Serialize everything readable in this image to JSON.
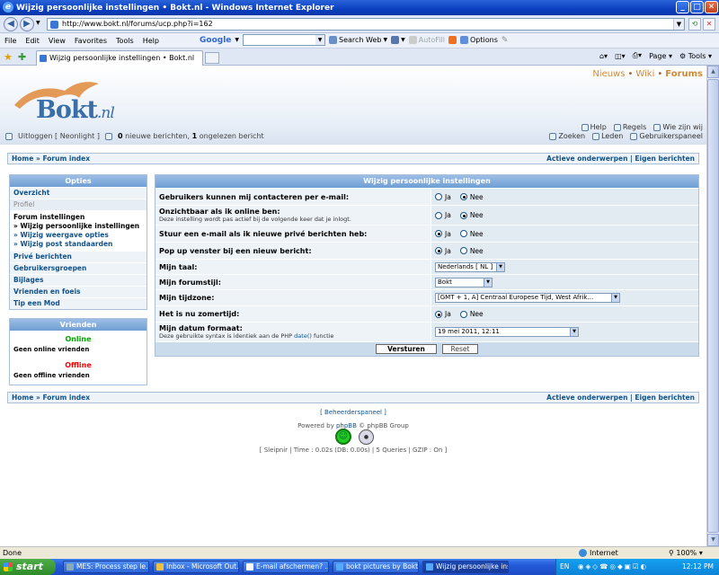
{
  "browser": {
    "window_title": "Wijzig persoonlijke instellingen • Bokt.nl - Windows Internet Explorer",
    "address": "http://www.bokt.nl/forums/ucp.php?i=162",
    "menu": [
      "File",
      "Edit",
      "View",
      "Favorites",
      "Tools",
      "Help"
    ],
    "google_label": "Google",
    "search_web_label": "Search Web",
    "autofill_label": "AutoFill",
    "options_label": "Options",
    "tab_title": "Wijzig persoonlijke instellingen • Bokt.nl",
    "page_label": "Page",
    "tools_label": "Tools",
    "status_left": "Done",
    "status_zone": "Internet",
    "zoom": "100%"
  },
  "site": {
    "topnav": [
      "Nieuws",
      "Wiki",
      "Forums"
    ],
    "logo_main": "Bokt",
    "logo_suffix": ".nl",
    "links_row1": [
      "Help",
      "Regels",
      "Wie zijn wij"
    ],
    "links_row2": [
      "Zoeken",
      "Leden",
      "Gebruikerspaneel"
    ],
    "logout_text": "Uitloggen [ Neonlight ]",
    "messages_count_new": "0",
    "messages_new_text": "nieuwe berichten,",
    "messages_count_unread": "1",
    "messages_unread_text": "ongelezen bericht",
    "crumb_home": "Home",
    "crumb_sep": "»",
    "crumb_index": "Forum index",
    "crumb_active": "Actieve onderwerpen",
    "crumb_own": "Eigen berichten"
  },
  "left": {
    "options_header": "Opties",
    "overview": "Overzicht",
    "profile": "Profiel",
    "forum_settings": "Forum instellingen",
    "sub1": "» Wijzig persoonlijke instellingen",
    "sub2": "» Wijzig weergave opties",
    "sub3": "» Wijzig post standaarden",
    "pm": "Privé berichten",
    "groups": "Gebruikersgroepen",
    "attachments": "Bijlages",
    "friends_foes": "Vrienden en foeis",
    "tip": "Tip een Mod",
    "friends_header": "Vrienden",
    "online": "Online",
    "no_online": "Geen online vrienden",
    "offline": "Offline",
    "no_offline": "Geen offline vrienden"
  },
  "form": {
    "header": "Wijzig persoonlijke instellingen",
    "yes": "Ja",
    "no": "Nee",
    "q1": "Gebruikers kunnen mij contacteren per e-mail:",
    "q2": "Onzichtbaar als ik online ben:",
    "q2_note": "Deze instelling wordt pas actief bij de volgende keer dat je inlogt.",
    "q3": "Stuur een e-mail als ik nieuwe privé berichten heb:",
    "q4": "Pop up venster bij een nieuw bericht:",
    "q5": "Mijn taal:",
    "q5_val": "Nederlands [ NL ]",
    "q6": "Mijn forumstijl:",
    "q6_val": "Bokt",
    "q7": "Mijn tijdzone:",
    "q7_val": "[GMT + 1, A] Centraal Europese Tijd, West Afrik...",
    "q8": "Het is nu zomertijd:",
    "q9": "Mijn datum formaat:",
    "q9_note": "Deze gebruikte syntax is identiek aan de PHP",
    "q9_link": "date()",
    "q9_note2": "functie",
    "q9_val": "19 mei 2011, 12:11",
    "submit": "Versturen",
    "reset": "Reset",
    "selections": {
      "q1": "no",
      "q2": "no",
      "q3": "yes",
      "q4": "yes",
      "q8": "yes"
    }
  },
  "footer": {
    "admin": "[ Beheerderspaneel ]",
    "powered": "Powered by",
    "phpbb": "phpBB",
    "group": "© phpBB Group",
    "stats": "[ Sleipnir | Time : 0.02s (DB: 0.00s) | 5 Queries | GZIP : On ]"
  },
  "taskbar": {
    "start": "start",
    "tasks": [
      "MES: Process step le...",
      "Inbox - Microsoft Out...",
      "E-mail afschermen? ...",
      "bokt pictures by Bokt...",
      "Wijzig persoonlijke ins..."
    ],
    "lang": "EN",
    "clock": "12:12 PM"
  }
}
